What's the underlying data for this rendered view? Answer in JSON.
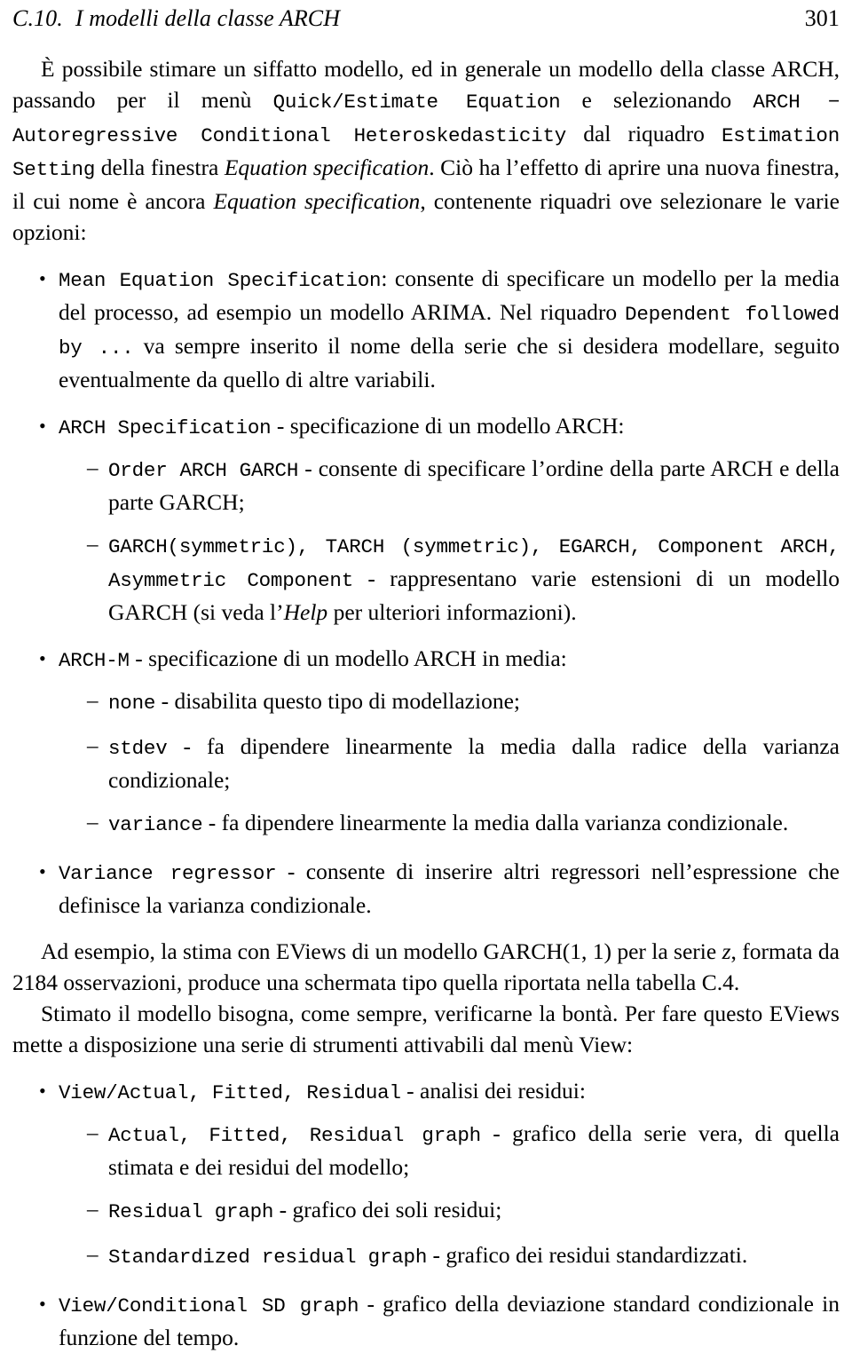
{
  "header": {
    "section_number": "C.10.",
    "section_title": "I modelli della classe ARCH",
    "page_number": "301"
  },
  "intro": {
    "t1": "È possibile stimare un siffatto modello, ed in generale un modello della classe ARCH, passando per il menù ",
    "m1": "Quick/Estimate Equation",
    "t2": " e selezionando ",
    "m2": "ARCH − Autoregressive Conditional Heteroskedasticity",
    "t3": " dal riquadro ",
    "m3": "Estimation Setting",
    "t4": " della finestra ",
    "i1": "Equation specification",
    "t5": ". Ciò ha l’effetto di aprire una nuova finestra, il cui nome è ancora ",
    "i2": "Equation specification",
    "t6": ", contenente riquadri ove selezionare le varie opzioni:"
  },
  "bullets": {
    "mean_equation": {
      "marker": "•",
      "m1": "Mean Equation Specification",
      "t1": ": consente di specificare un modello per la media del processo, ad esempio un modello ARIMA. Nel riquadro ",
      "m2": "Dependent followed by ...",
      "t2": " va sempre inserito il nome della serie che si desidera modellare, seguito eventualmente da quello di altre variabili."
    },
    "arch_specification": {
      "marker": "•",
      "m1": "ARCH Specification",
      "t1": " - specificazione di un modello ARCH:",
      "sub": [
        {
          "marker": "–",
          "m1": "Order ARCH GARCH",
          "t1": " - consente di specificare l’ordine della parte ARCH e della parte GARCH;"
        },
        {
          "marker": "–",
          "m1": "GARCH(symmetric), TARCH (symmetric), EGARCH, Component ARCH, Asymmetric Component",
          "t1": " - rappresentano varie estensioni di un modello GARCH (si veda l’",
          "i1": "Help",
          "t2": " per ulteriori informazioni)."
        }
      ]
    },
    "arch_m": {
      "marker": "•",
      "m1": "ARCH-M",
      "t1": " - specificazione di un modello ARCH in media:",
      "sub": [
        {
          "marker": "–",
          "m1": "none",
          "t1": " - disabilita questo tipo di modellazione;"
        },
        {
          "marker": "–",
          "m1": "stdev",
          "t1": " - fa dipendere linearmente la media dalla radice della varianza condizionale;"
        },
        {
          "marker": "–",
          "m1": "variance",
          "t1": " - fa dipendere linearmente la media dalla varianza condizionale."
        }
      ]
    },
    "variance_regressor": {
      "marker": "•",
      "m1": "Variance regressor",
      "t1": " - consente di inserire altri regressori nell’espressione che definisce la varianza condizionale."
    },
    "view_afr": {
      "marker": "•",
      "m1": "View/Actual, Fitted, Residual",
      "t1": " - analisi dei residui:",
      "sub": [
        {
          "marker": "–",
          "m1": "Actual, Fitted, Residual graph",
          "t1": " - grafico della serie vera, di quella stimata e dei residui del modello;"
        },
        {
          "marker": "–",
          "m1": "Residual graph",
          "t1": " - grafico dei soli residui;"
        },
        {
          "marker": "–",
          "m1": "Standardized residual graph",
          "t1": " - grafico dei residui standardizzati."
        }
      ]
    },
    "view_csd": {
      "marker": "•",
      "m1": "View/Conditional SD graph",
      "t1": " - grafico della deviazione standard condizionale in funzione del tempo."
    }
  },
  "example": {
    "t1": "Ad esempio, la stima con EViews di un modello GARCH(1, 1) per la serie ",
    "v1": "z",
    "t2": ", formata da 2184 osservazioni, produce una schermata tipo quella riportata nella tabella C.4."
  },
  "closing": {
    "t1": "Stimato il modello bisogna, come sempre, verificarne la bontà. Per fare questo EViews mette a disposizione una serie di strumenti attivabili dal menù View:"
  }
}
